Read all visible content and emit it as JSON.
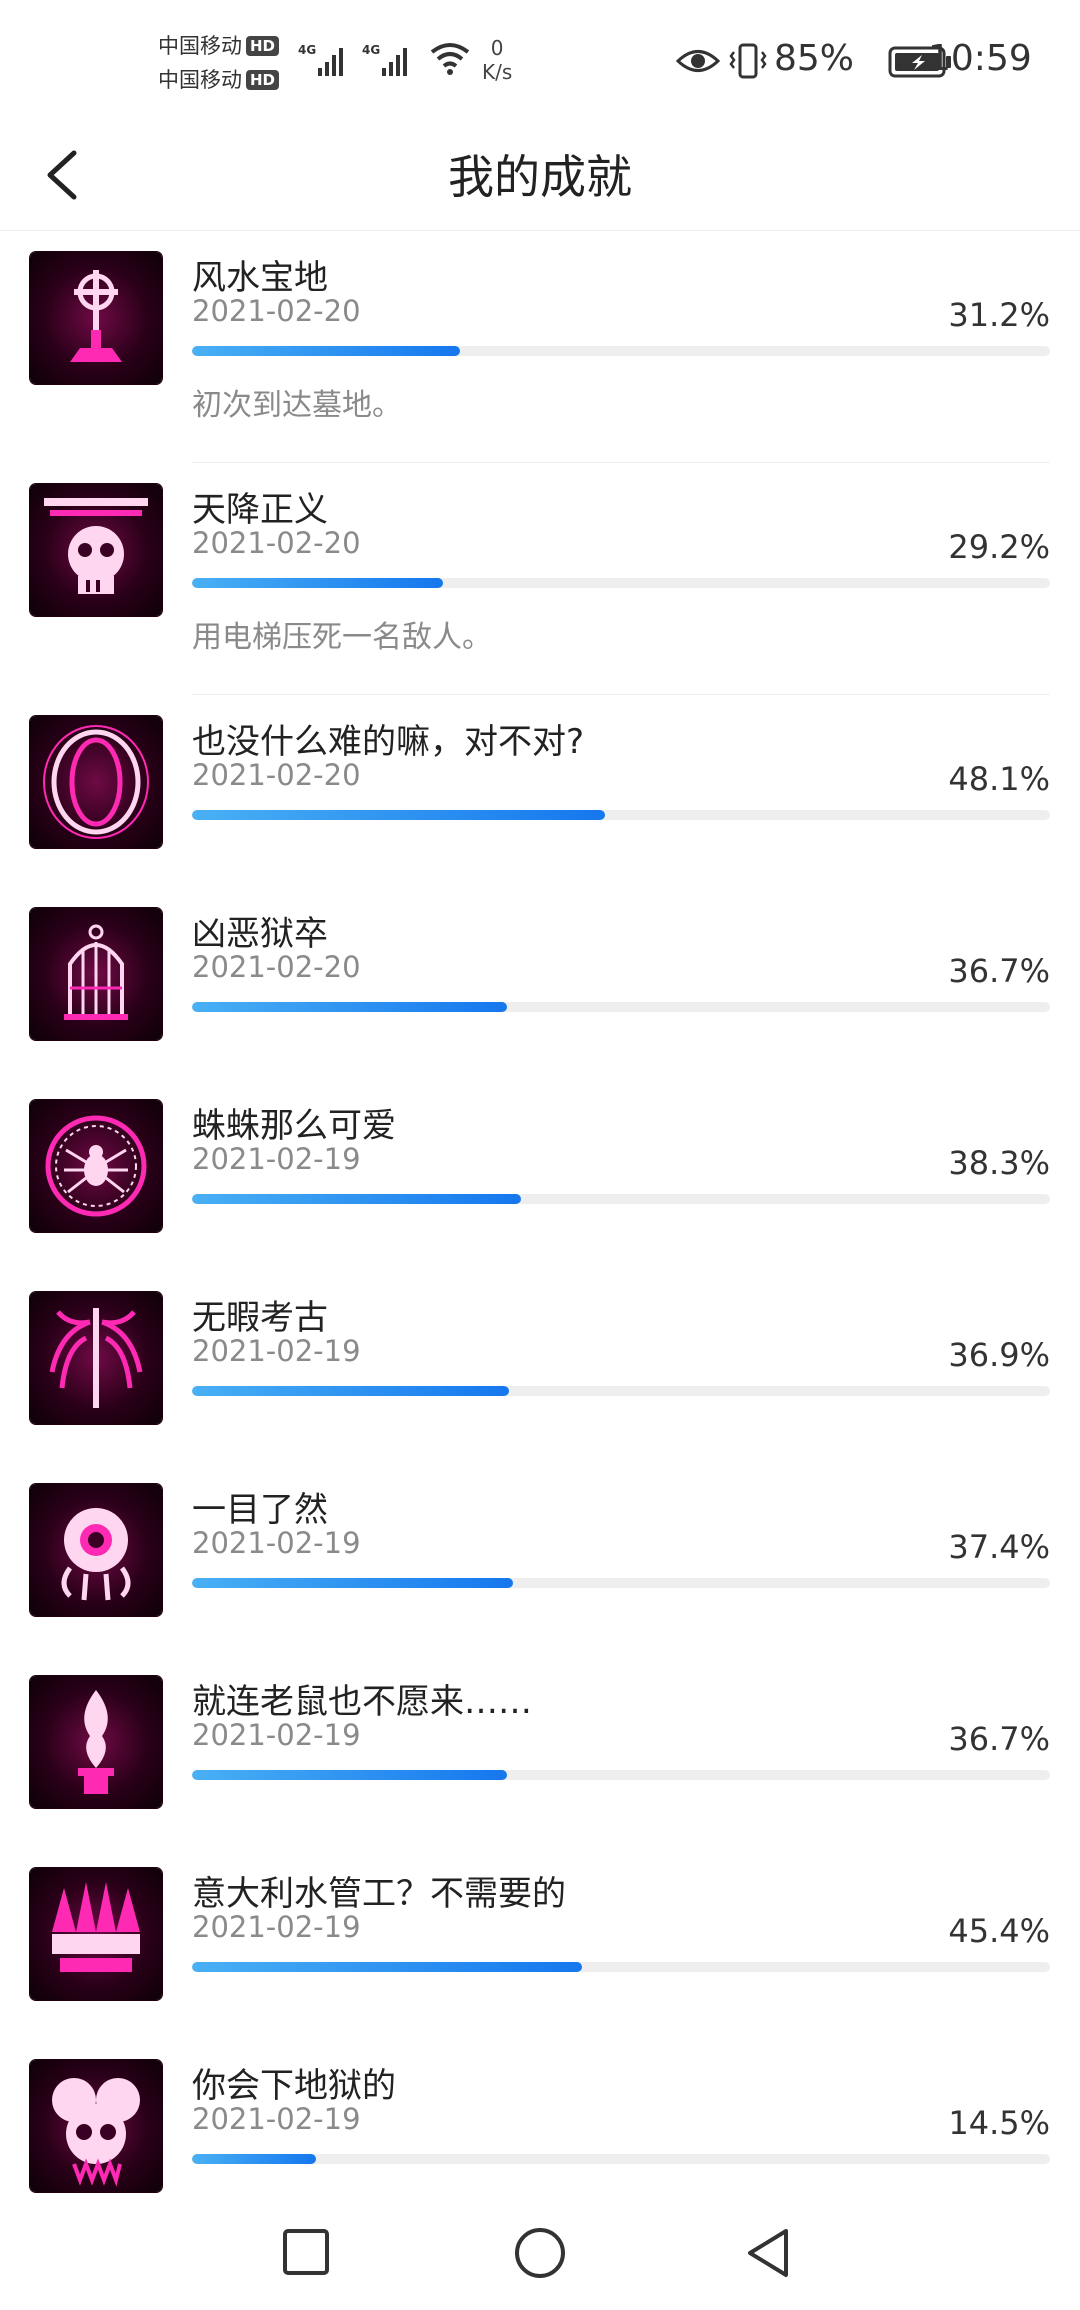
{
  "status_bar": {
    "carrier1": "中国移动",
    "carrier2": "中国移动",
    "hd_badge": "HD",
    "network1": "4G",
    "network2": "4G",
    "speed_value": "0",
    "speed_unit": "K/s",
    "battery": "85%",
    "time": "10:59"
  },
  "header": {
    "title": "我的成就"
  },
  "achievements": [
    {
      "name": "风水宝地",
      "date": "2021-02-20",
      "percent": "31.2%",
      "progress": 0.312,
      "description": "初次到达墓地。",
      "icon": "grave-cross-icon"
    },
    {
      "name": "天降正义",
      "date": "2021-02-20",
      "percent": "29.2%",
      "progress": 0.292,
      "description": "用电梯压死一名敌人。",
      "icon": "skull-elevator-icon"
    },
    {
      "name": "也没什么难的嘛，对不对?",
      "date": "2021-02-20",
      "percent": "48.1%",
      "progress": 0.481,
      "description": "",
      "icon": "portal-ring-icon"
    },
    {
      "name": "凶恶狱卒",
      "date": "2021-02-20",
      "percent": "36.7%",
      "progress": 0.367,
      "description": "",
      "icon": "birdcage-icon"
    },
    {
      "name": "蛛蛛那么可爱",
      "date": "2021-02-19",
      "percent": "38.3%",
      "progress": 0.383,
      "description": "",
      "icon": "spider-icon"
    },
    {
      "name": "无暇考古",
      "date": "2021-02-19",
      "percent": "36.9%",
      "progress": 0.369,
      "description": "",
      "icon": "ribcage-icon"
    },
    {
      "name": "一目了然",
      "date": "2021-02-19",
      "percent": "37.4%",
      "progress": 0.374,
      "description": "",
      "icon": "eyeball-monster-icon"
    },
    {
      "name": "就连老鼠也不愿来……",
      "date": "2021-02-19",
      "percent": "36.7%",
      "progress": 0.367,
      "description": "",
      "icon": "flame-pedestal-icon"
    },
    {
      "name": "意大利水管工？不需要的",
      "date": "2021-02-19",
      "percent": "45.4%",
      "progress": 0.454,
      "description": "",
      "icon": "spiked-crown-icon"
    },
    {
      "name": "你会下地狱的",
      "date": "2021-02-19",
      "percent": "14.5%",
      "progress": 0.145,
      "description": "",
      "icon": "demon-skull-icon"
    }
  ],
  "colors": {
    "accent": "#1677ee",
    "icon_glow": "#ff2ab4"
  }
}
